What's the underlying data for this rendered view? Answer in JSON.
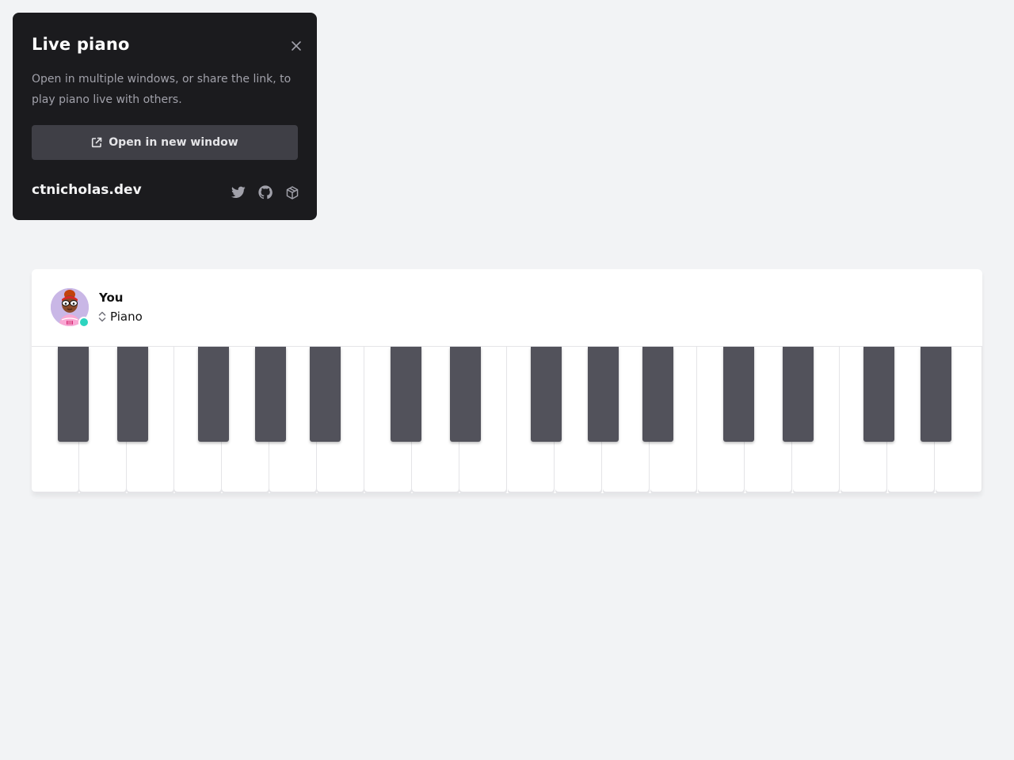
{
  "panel": {
    "title": "Live piano",
    "description": "Open in multiple windows, or share the link, to play piano live with others.",
    "open_button_label": "Open in new window",
    "site_name": "ctnicholas.dev",
    "social_icons": [
      "twitter-icon",
      "github-icon",
      "codesandbox-icon"
    ],
    "close_icon": "close-icon"
  },
  "player": {
    "name": "You",
    "instrument": "Piano",
    "status": "online"
  },
  "keyboard": {
    "white_key_count": 20,
    "black_key_count": 14
  },
  "colors": {
    "page_background": "#f2f3f5",
    "panel_background": "#1b1b1e",
    "button_background": "#3f3f46",
    "black_key": "#52525b",
    "online_status": "#2dd4bf",
    "avatar_background": "#c9b7e6"
  }
}
